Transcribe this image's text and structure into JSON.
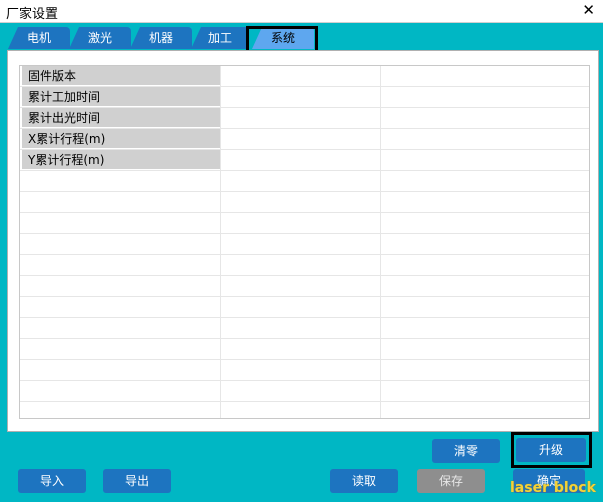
{
  "window": {
    "title": "厂家设置",
    "close_glyph": "✕"
  },
  "tabs": [
    {
      "label": "电机",
      "active": false
    },
    {
      "label": "激光",
      "active": false
    },
    {
      "label": "机器",
      "active": false
    },
    {
      "label": "加工",
      "active": false
    },
    {
      "label": "系统",
      "active": true
    }
  ],
  "table": {
    "rows": [
      {
        "label": "固件版本",
        "value": "",
        "extra": ""
      },
      {
        "label": "累计工加时间",
        "value": "",
        "extra": ""
      },
      {
        "label": "累计出光时间",
        "value": "",
        "extra": ""
      },
      {
        "label": "X累计行程(m)",
        "value": "",
        "extra": ""
      },
      {
        "label": "Y累计行程(m)",
        "value": "",
        "extra": ""
      }
    ]
  },
  "buttons": {
    "clear": "清零",
    "upgrade": "升级",
    "import": "导入",
    "export": "导出",
    "read": "读取",
    "save": "保存",
    "confirm": "确定"
  },
  "watermark": "laser block",
  "colors": {
    "background": "#00b7c4",
    "button": "#1d74c0",
    "active_tab": "#5ea7ef",
    "disabled_button": "#8e8e8e"
  }
}
